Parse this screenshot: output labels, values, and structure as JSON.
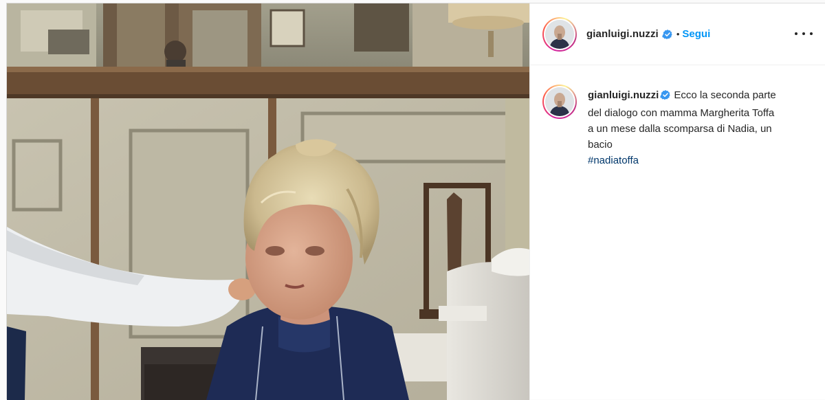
{
  "post": {
    "author": {
      "username": "gianluigi.nuzzi",
      "verified": true,
      "follow_label": "Segui",
      "separator": "•"
    },
    "more_options_icon": "more-horizontal-icon",
    "caption": {
      "username": "gianluigi.nuzzi",
      "text": "Ecco la seconda parte del dialogo con mamma Margherita Toffa a un mese dalla scomparsa di Nadia, un bacio",
      "hashtag": "#nadiatoffa"
    },
    "media": {
      "type": "video-frame",
      "scene": "woman with blond hair seated at a restaurant table"
    }
  },
  "colors": {
    "accent_blue": "#0095f6",
    "verified_blue": "#3897f0",
    "hashtag_blue": "#00376b",
    "text": "#262626",
    "border": "#dbdbdb"
  }
}
